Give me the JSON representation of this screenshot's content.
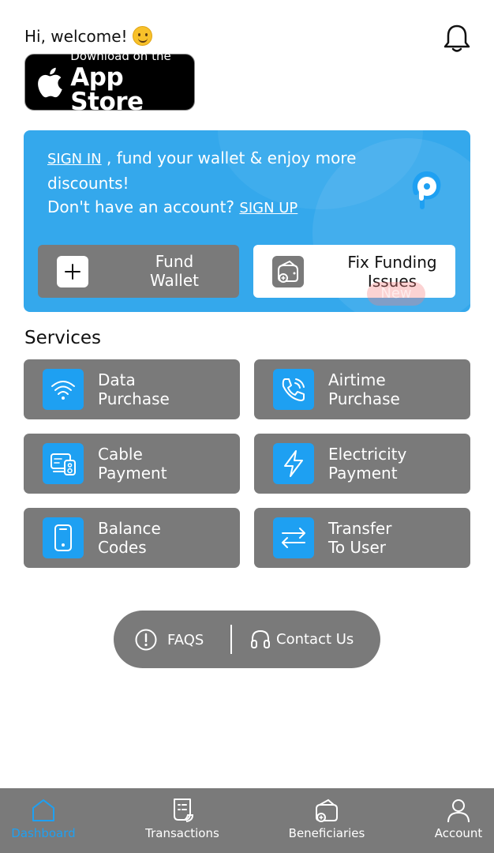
{
  "header": {
    "greeting": "Hi, welcome!",
    "emoji": "smiling-face",
    "bell_icon": "bell-icon"
  },
  "appstore": {
    "small_text": "Download on the",
    "big_text": "App Store"
  },
  "banner": {
    "sign_in": "SIGN IN",
    "message": " , fund your wallet & enjoy more discounts!",
    "no_account": "Don't have an account? ",
    "sign_up": "SIGN UP",
    "fund_wallet": "Fund Wallet",
    "fix_funding": "Fix Funding Issues",
    "new_badge": "New",
    "background_color": "#34a8ec"
  },
  "services": {
    "title": "Services",
    "items": [
      {
        "label_1": "Data",
        "label_2": "Purchase",
        "icon": "wifi-icon"
      },
      {
        "label_1": "Airtime",
        "label_2": "Purchase",
        "icon": "phone-icon"
      },
      {
        "label_1": "Cable",
        "label_2": "Payment",
        "icon": "cable-tv-icon"
      },
      {
        "label_1": "Electricity",
        "label_2": "Payment",
        "icon": "lightning-icon"
      },
      {
        "label_1": "Balance",
        "label_2": "Codes",
        "icon": "mobile-icon"
      },
      {
        "label_1": "Transfer",
        "label_2": "To User",
        "icon": "transfer-icon"
      }
    ]
  },
  "help": {
    "faqs": "FAQS",
    "contact": "Contact Us"
  },
  "nav": {
    "items": [
      {
        "label": "Dashboard",
        "icon": "home-icon",
        "active": true
      },
      {
        "label": "Transactions",
        "icon": "receipt-icon",
        "active": false
      },
      {
        "label": "Beneficiaries",
        "icon": "wallet-add-icon",
        "active": false
      },
      {
        "label": "Account",
        "icon": "user-icon",
        "active": false
      }
    ]
  },
  "colors": {
    "accent": "#1ea0f2",
    "card_gray": "#7a7a7a"
  }
}
